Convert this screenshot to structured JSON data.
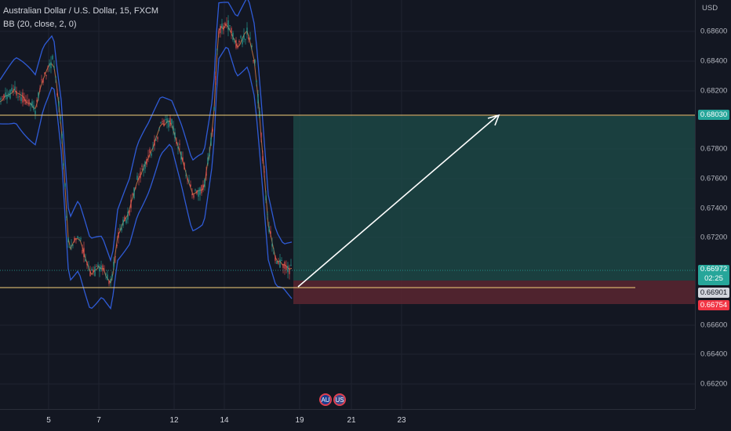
{
  "legend": {
    "symbol": "Australian Dollar / U.S. Dollar, 15, FXCM",
    "indicator": "BB (20, close, 2, 0)"
  },
  "price_scale": {
    "unit": "USD",
    "ticks": [
      "0.68600",
      "0.68400",
      "0.68200",
      "0.67800",
      "0.67600",
      "0.67400",
      "0.67200",
      "0.66600",
      "0.66400",
      "0.66200"
    ],
    "target_label": "0.68030",
    "current_price": "0.66972",
    "countdown": "02:25",
    "entry_label": "0.66901",
    "stop_label": "0.66754"
  },
  "time_axis": {
    "labels": [
      "5",
      "7",
      "12",
      "14",
      "19",
      "21",
      "23"
    ]
  },
  "flags": [
    {
      "icon": "australia-flag-icon",
      "glyph": "AU"
    },
    {
      "icon": "usa-flag-icon",
      "glyph": "US"
    }
  ],
  "colors": {
    "background": "#131722",
    "target_line": "#f5d27a",
    "profit_zone": "#1d4e4a",
    "loss_zone": "#5a2630",
    "bollinger": "#2f5bd6",
    "candle_up": "#26a69a",
    "candle_down": "#ef5350",
    "current_price_tag": "#26a69a",
    "stop_tag": "#f23645"
  }
}
